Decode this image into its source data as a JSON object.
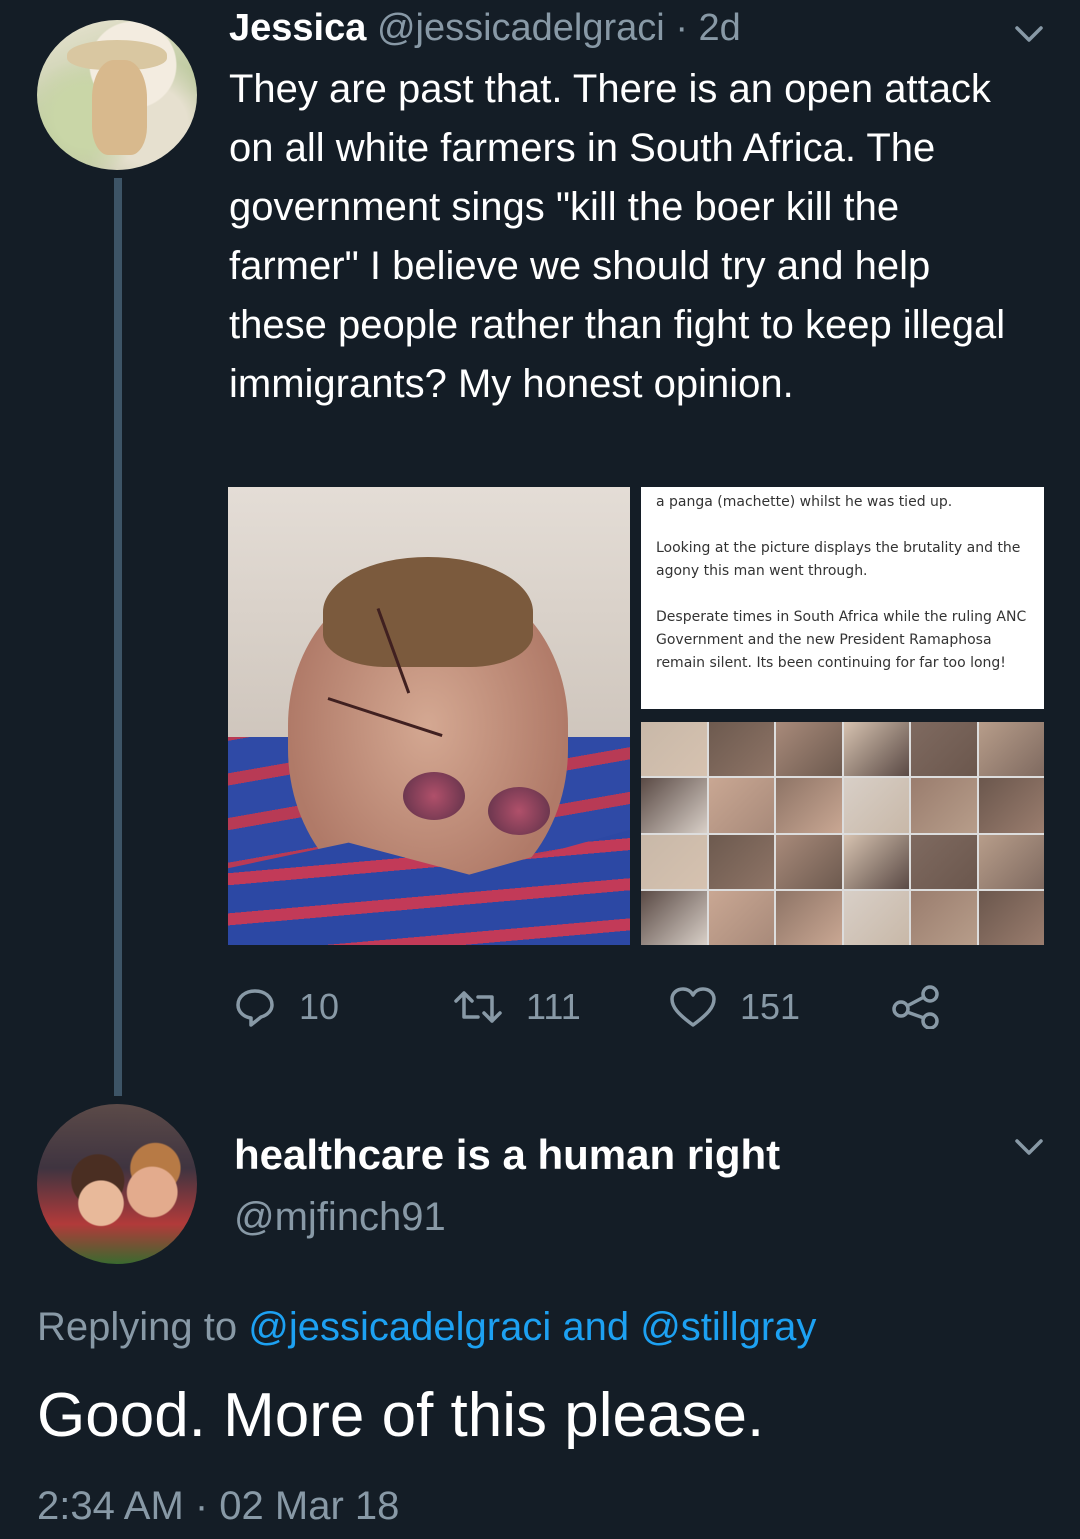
{
  "tweet1": {
    "name": "Jessica",
    "handle": "@jessicadelgraci",
    "separator": "·",
    "time": "2d",
    "text": "They are past that. There is an open attack on all white farmers in South Africa. The government sings \"kill the boer kill the farmer\" I believe we should try and help these people rather than fight to keep illegal immigrants? My honest opinion.",
    "media_note": {
      "line1": "a panga (machette)  whilst he was tied up.",
      "para2": "Looking at the picture displays the brutality and the agony this man went through.",
      "para3": "Desperate times in South Africa while the ruling ANC Government and the new President Ramaphosa remain silent. Its been continuing for far too long!"
    },
    "actions": {
      "replies": "10",
      "retweets": "111",
      "likes": "151"
    }
  },
  "tweet2": {
    "name": "healthcare is a human right",
    "handle": "@mjfinch91",
    "replying_prefix": "Replying to",
    "replying_user1": "@jessicadelgraci",
    "replying_and": "and",
    "replying_user2": "@stillgray",
    "text": "Good. More of this please.",
    "timestamp": "2:34 AM · 02 Mar 18"
  },
  "icons": [
    "reply-icon",
    "retweet-icon",
    "like-icon",
    "share-icon",
    "chevron-down-icon"
  ],
  "colors": {
    "background": "#141d26",
    "text": "#ffffff",
    "muted": "#8899a6",
    "link": "#1da1f2",
    "thread_line": "#3d5466"
  }
}
